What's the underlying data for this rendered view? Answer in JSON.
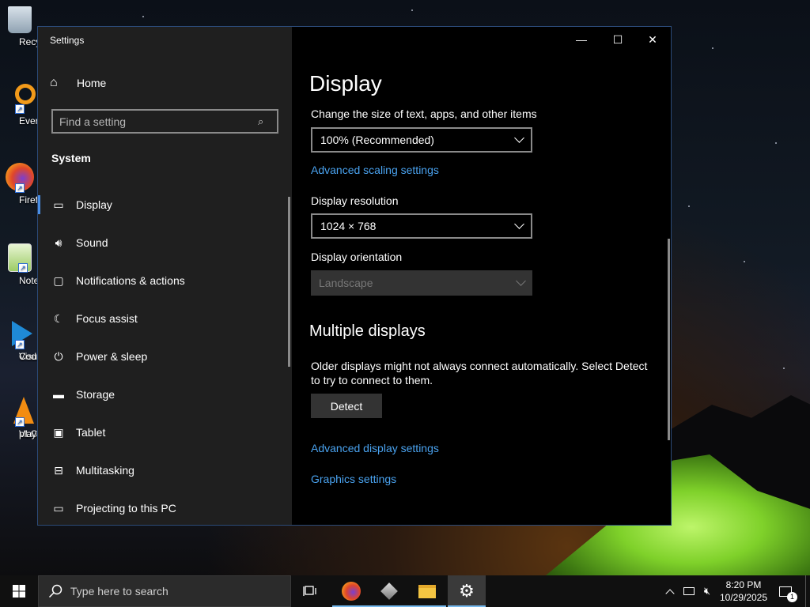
{
  "desktop": {
    "icons": [
      {
        "label": "Recycle",
        "icon": "recycle-bin-icon"
      },
      {
        "label": "Everyth",
        "icon": "everything-search-icon"
      },
      {
        "label": "Firefo",
        "icon": "firefox-icon"
      },
      {
        "label": "Notepa",
        "icon": "notepad-icon"
      },
      {
        "label": "Visual St",
        "label2": "Cod",
        "icon": "vscode-icon"
      },
      {
        "label": "VLC me",
        "label2": "playe",
        "icon": "vlc-icon"
      }
    ]
  },
  "window": {
    "title": "Settings",
    "controls": {
      "minimize": "—",
      "maximize": "☐",
      "close": "✕"
    }
  },
  "sidebar": {
    "home_label": "Home",
    "search_placeholder": "Find a setting",
    "section": "System",
    "items": [
      {
        "label": "Display",
        "icon": "monitor-icon",
        "glyph": "▭"
      },
      {
        "label": "Sound",
        "icon": "speaker-icon",
        "glyph": "🔊︎"
      },
      {
        "label": "Notifications & actions",
        "icon": "notification-icon",
        "glyph": "▢"
      },
      {
        "label": "Focus assist",
        "icon": "moon-icon",
        "glyph": "☾"
      },
      {
        "label": "Power & sleep",
        "icon": "power-icon",
        "glyph": "⏻"
      },
      {
        "label": "Storage",
        "icon": "storage-icon",
        "glyph": "▬"
      },
      {
        "label": "Tablet",
        "icon": "tablet-icon",
        "glyph": "▣"
      },
      {
        "label": "Multitasking",
        "icon": "multitasking-icon",
        "glyph": "⊟"
      },
      {
        "label": "Projecting to this PC",
        "icon": "projector-icon",
        "glyph": "▭"
      }
    ],
    "active_index": 0
  },
  "content": {
    "title": "Display",
    "scale_label": "Change the size of text, apps, and other items",
    "scale_value": "100% (Recommended)",
    "advanced_scaling_link": "Advanced scaling settings",
    "resolution_label": "Display resolution",
    "resolution_value": "1024 × 768",
    "orientation_label": "Display orientation",
    "orientation_value": "Landscape",
    "multiple_displays_heading": "Multiple displays",
    "multiple_displays_text": "Older displays might not always connect automatically. Select Detect to try to connect to them.",
    "detect_button": "Detect",
    "advanced_display_link": "Advanced display settings",
    "graphics_link": "Graphics settings"
  },
  "taskbar": {
    "search_placeholder": "Type here to search",
    "time": "8:20 PM",
    "date": "10/29/2025",
    "notification_count": "1"
  },
  "colors": {
    "accent": "#4a8fe7",
    "link": "#4aa3f0",
    "sidebar_bg": "#1f1f1f",
    "content_bg": "#000000"
  }
}
